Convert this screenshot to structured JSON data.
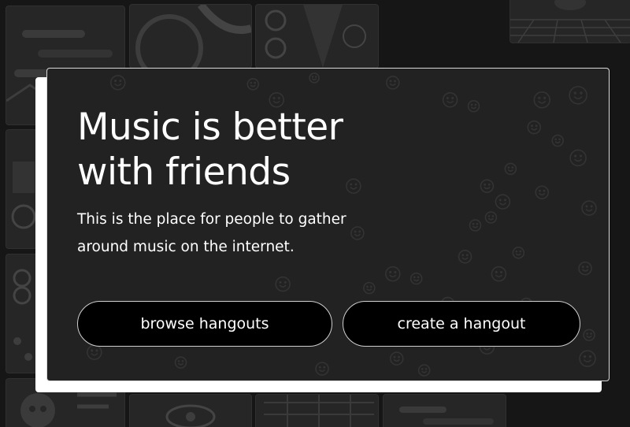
{
  "hero": {
    "headline_line1": "Music is better",
    "headline_line2": "with friends",
    "description_line1": "This is the place for people to gather",
    "description_line2": "around music on the internet."
  },
  "actions": {
    "browse_label": "browse hangouts",
    "create_label": "create a hangout"
  },
  "colors": {
    "page_background": "#161616",
    "card_background": "#222222",
    "card_shadow": "#ffffff",
    "button_background": "#000000",
    "text": "#ffffff"
  },
  "icons": {
    "background_pattern": "smiley-face-icon"
  }
}
